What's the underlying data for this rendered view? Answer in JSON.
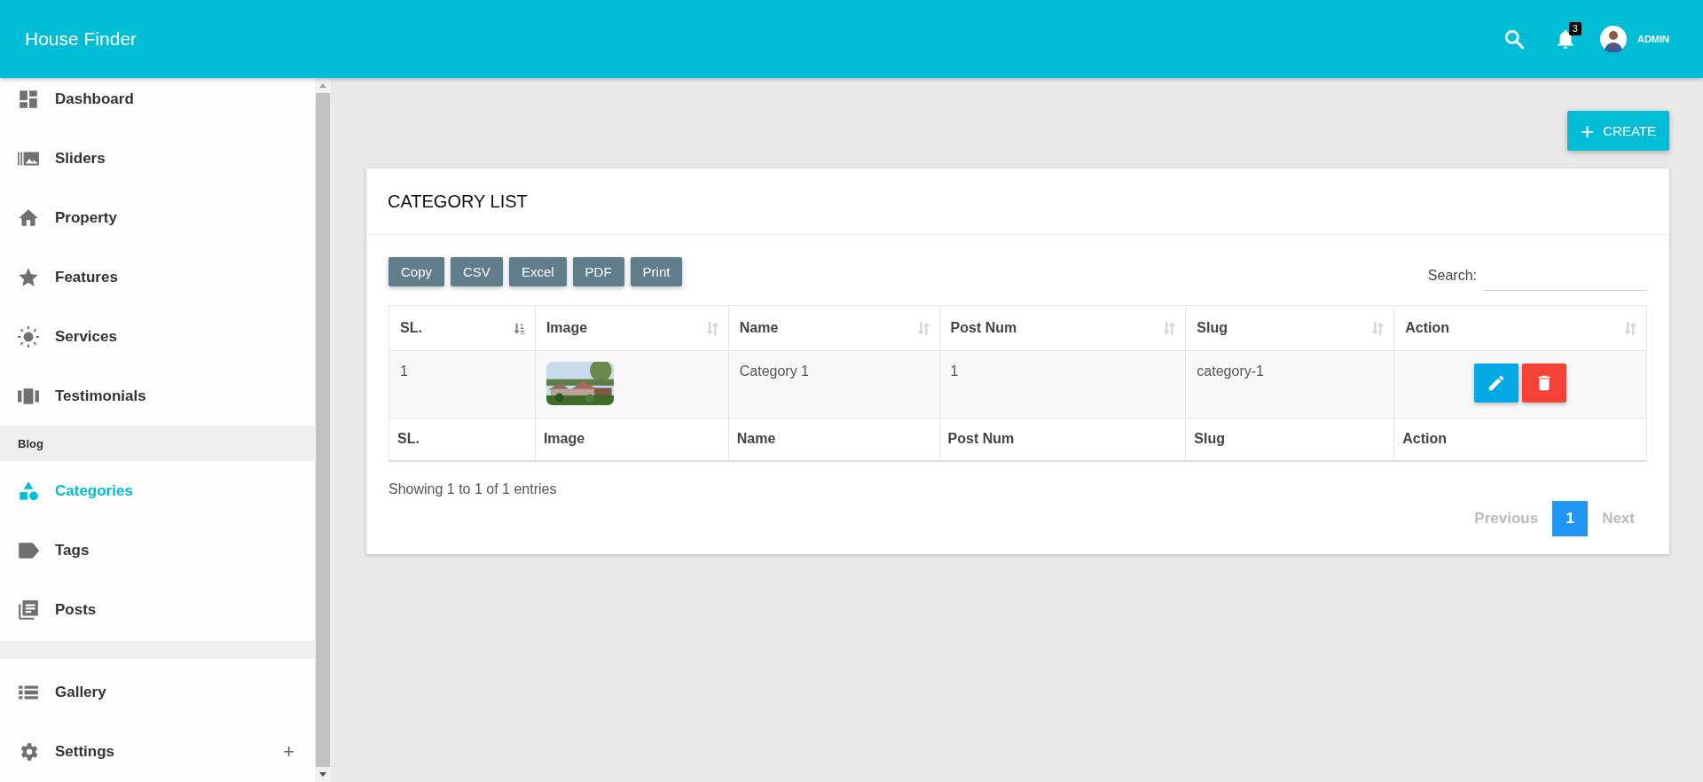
{
  "header": {
    "title": "House Finder",
    "notification_count": "3",
    "user": "ADMIN"
  },
  "sidebar": {
    "items": [
      {
        "kind": "item",
        "label": "Dashboard",
        "selected": false
      },
      {
        "kind": "item",
        "label": "Sliders",
        "selected": false
      },
      {
        "kind": "item",
        "label": "Property",
        "selected": false
      },
      {
        "kind": "item",
        "label": "Features",
        "selected": false
      },
      {
        "kind": "item",
        "label": "Services",
        "selected": false
      },
      {
        "kind": "item",
        "label": "Testimonials",
        "selected": false
      },
      {
        "kind": "header",
        "label": "Blog"
      },
      {
        "kind": "item",
        "label": "Categories",
        "selected": true
      },
      {
        "kind": "item",
        "label": "Tags",
        "selected": false
      },
      {
        "kind": "item",
        "label": "Posts",
        "selected": false
      },
      {
        "kind": "divider"
      },
      {
        "kind": "item",
        "label": "Gallery",
        "selected": false
      },
      {
        "kind": "item",
        "label": "Settings",
        "selected": false,
        "expand": "+"
      }
    ]
  },
  "create_button": {
    "icon": "+",
    "label": "CREATE"
  },
  "card": {
    "title": "CATEGORY LIST",
    "export_buttons": [
      "Copy",
      "CSV",
      "Excel",
      "PDF",
      "Print"
    ],
    "search_label": "Search:",
    "table": {
      "columns": [
        {
          "label": "SL.",
          "sorted": true
        },
        {
          "label": "Image",
          "sorted": false
        },
        {
          "label": "Name",
          "sorted": false
        },
        {
          "label": "Post Num",
          "sorted": false
        },
        {
          "label": "Slug",
          "sorted": false
        },
        {
          "label": "Action",
          "sorted": false
        }
      ],
      "rows": [
        {
          "sl": "1",
          "name": "Category 1",
          "post_num": "1",
          "slug": "category-1"
        }
      ],
      "footer": [
        "SL.",
        "Image",
        "Name",
        "Post Num",
        "Slug",
        "Action"
      ]
    },
    "info": "Showing 1 to 1 of 1 entries",
    "pagination": {
      "previous": {
        "label": "Previous",
        "disabled": true
      },
      "pages": [
        {
          "label": "1",
          "selected": true
        }
      ],
      "next": {
        "label": "Next",
        "disabled": true
      }
    }
  }
}
